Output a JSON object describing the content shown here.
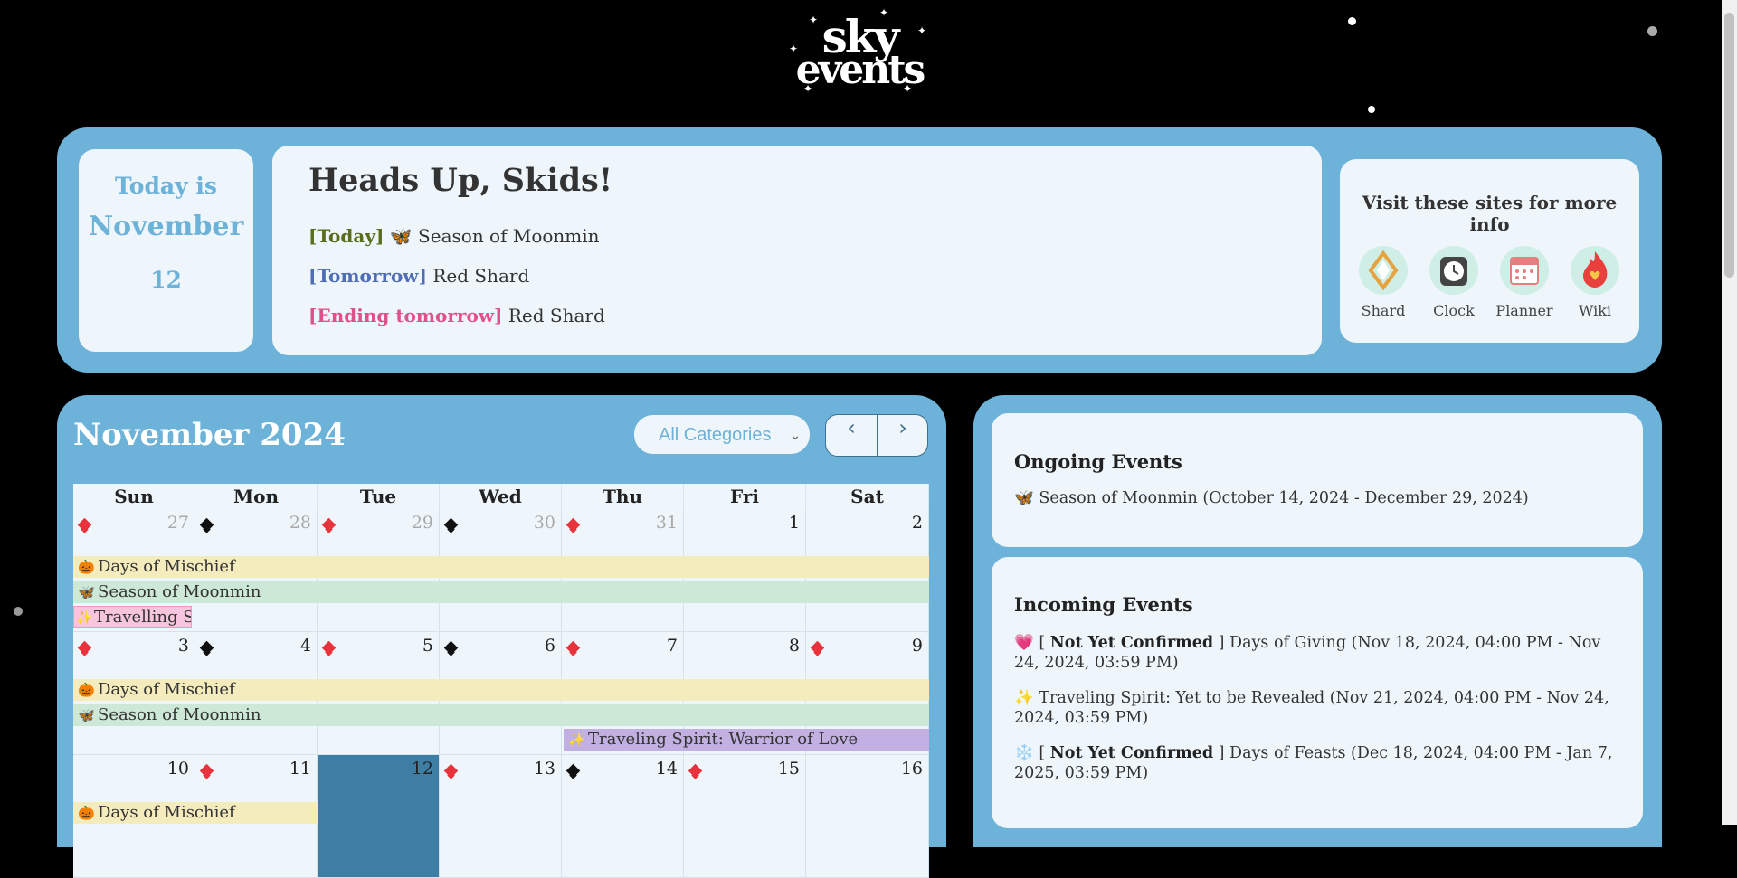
{
  "logo": {
    "line1": "sky",
    "line2": "events"
  },
  "today": {
    "label": "Today is",
    "month": "November",
    "day": "12"
  },
  "heads_up": {
    "title": "Heads Up, Skids!",
    "lines": [
      {
        "tag": "[Today]",
        "icon": "🦋",
        "text": "Season of Moonmin"
      },
      {
        "tag": "[Tomorrow]",
        "icon": "",
        "text": "Red Shard"
      },
      {
        "tag": "[Ending tomorrow]",
        "icon": "",
        "text": "Red Shard"
      }
    ]
  },
  "sites": {
    "title": "Visit these sites for more info",
    "items": [
      {
        "label": "Shard",
        "icon": "shard-icon"
      },
      {
        "label": "Clock",
        "icon": "clock-icon"
      },
      {
        "label": "Planner",
        "icon": "calendar-icon"
      },
      {
        "label": "Wiki",
        "icon": "flame-icon"
      }
    ]
  },
  "calendar": {
    "title": "November 2024",
    "category_select": {
      "value": "All Categories"
    },
    "nav": {
      "prev": "‹",
      "next": "›"
    },
    "weekdays": [
      "Sun",
      "Mon",
      "Tue",
      "Wed",
      "Thu",
      "Fri",
      "Sat"
    ],
    "weeks": [
      {
        "days": [
          "27",
          "28",
          "29",
          "30",
          "31",
          "1",
          "2"
        ]
      },
      {
        "days": [
          "3",
          "4",
          "5",
          "6",
          "7",
          "8",
          "9"
        ]
      },
      {
        "days": [
          "10",
          "11",
          "12",
          "13",
          "14",
          "15",
          "16"
        ]
      }
    ],
    "events": {
      "mischief": {
        "icon": "🎃",
        "label": "Days of Mischief"
      },
      "moonmin": {
        "icon": "🦋",
        "label": "Season of Moonmin"
      },
      "travelling": {
        "icon": "✨",
        "label": "Travelling S"
      },
      "warrior": {
        "icon": "✨",
        "label": "Traveling Spirit: Warrior of Love"
      }
    },
    "colors": {
      "red_shard": "#e8333d",
      "black_shard": "#111111",
      "today": "#3e7ea5"
    }
  },
  "ongoing": {
    "title": "Ongoing Events",
    "items": [
      {
        "icon": "🦋",
        "text": "Season of Moonmin (October 14, 2024 - December 29, 2024)"
      }
    ]
  },
  "incoming": {
    "title": "Incoming Events",
    "items": [
      {
        "icon": "💗",
        "pre": "[",
        "badge": "Not Yet Confirmed",
        "post": "]",
        "text": "Days of Giving (Nov 18, 2024, 04:00 PM - Nov 24, 2024, 03:59 PM)"
      },
      {
        "icon": "✨",
        "pre": "",
        "badge": "",
        "post": "",
        "text": "Traveling Spirit: Yet to be Revealed (Nov 21, 2024, 04:00 PM - Nov 24, 2024, 03:59 PM)"
      },
      {
        "icon": "❄️",
        "pre": "[",
        "badge": "Not Yet Confirmed",
        "post": "]",
        "text": "Days of Feasts (Dec 18, 2024, 04:00 PM - Jan 7, 2025, 03:59 PM)"
      }
    ]
  }
}
